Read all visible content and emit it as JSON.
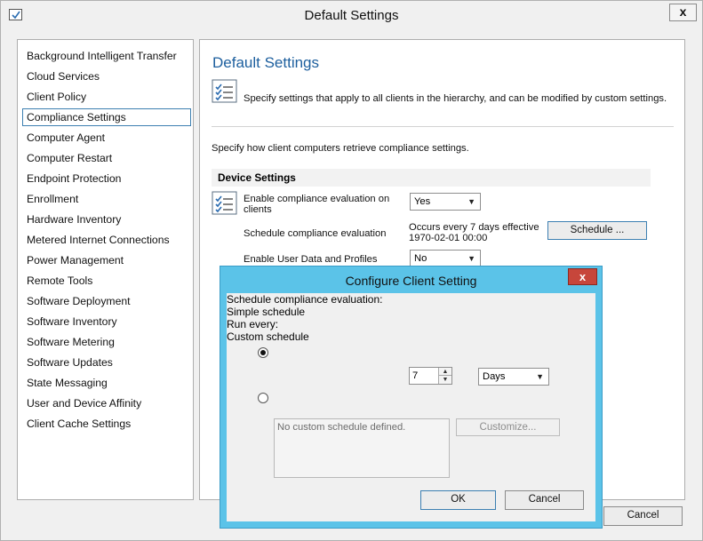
{
  "window": {
    "title": "Default Settings",
    "close_glyph": "x"
  },
  "sidebar": {
    "items": [
      {
        "label": "Background Intelligent Transfer"
      },
      {
        "label": "Cloud Services"
      },
      {
        "label": "Client Policy"
      },
      {
        "label": "Compliance Settings",
        "selected": true
      },
      {
        "label": "Computer Agent"
      },
      {
        "label": "Computer Restart"
      },
      {
        "label": "Endpoint Protection"
      },
      {
        "label": "Enrollment"
      },
      {
        "label": "Hardware Inventory"
      },
      {
        "label": "Metered Internet Connections"
      },
      {
        "label": "Power Management"
      },
      {
        "label": "Remote Tools"
      },
      {
        "label": "Software Deployment"
      },
      {
        "label": "Software Inventory"
      },
      {
        "label": "Software Metering"
      },
      {
        "label": "Software Updates"
      },
      {
        "label": "State Messaging"
      },
      {
        "label": "User and Device Affinity"
      },
      {
        "label": "Client Cache Settings"
      }
    ]
  },
  "main": {
    "heading": "Default Settings",
    "description": "Specify settings that apply to all clients in the hierarchy, and can be modified by custom settings.",
    "subheading": "Specify how client computers retrieve compliance settings.",
    "group_header": "Device Settings",
    "settings": {
      "enable_eval_label_1": "Enable compliance evaluation on",
      "enable_eval_label_2": "clients",
      "enable_eval_value": "Yes",
      "schedule_label": "Schedule compliance evaluation",
      "schedule_value_1": "Occurs every 7 days effective",
      "schedule_value_2": "1970-02-01 00:00",
      "schedule_button": "Schedule ...",
      "user_data_label": "Enable User Data and Profiles",
      "user_data_value": "No"
    },
    "cancel_button": "Cancel"
  },
  "dialog": {
    "title": "Configure Client Setting",
    "close_glyph": "x",
    "prompt": "Schedule compliance evaluation:",
    "simple_schedule": {
      "label": "Simple schedule",
      "selected": true
    },
    "run_every_label": "Run every:",
    "run_every_value": "7",
    "unit_value": "Days",
    "custom_schedule": {
      "label": "Custom schedule",
      "selected": false
    },
    "custom_placeholder": "No custom schedule defined.",
    "customize_button": "Customize...",
    "ok_button": "OK",
    "cancel_button": "Cancel"
  },
  "colors": {
    "dialog_frame": "#5bc3e8",
    "close_button": "#c7463b",
    "heading": "#1d5f9e",
    "selection_border": "#3c7fb1"
  },
  "icons": {
    "app": "checklist-icon",
    "header": "checklist-icon",
    "setting": "checklist-icon",
    "dropdown": "chevron-down-icon",
    "spin_up": "spin-up-icon",
    "spin_down": "spin-down-icon"
  }
}
